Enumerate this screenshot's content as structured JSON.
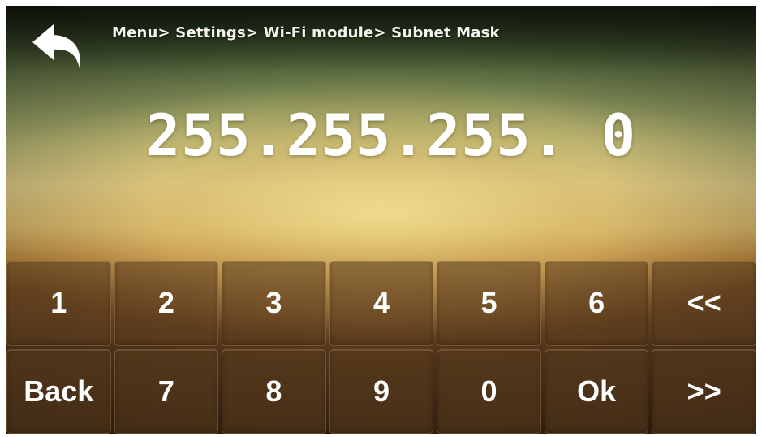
{
  "header": {
    "back_icon": "back-arrow-icon",
    "breadcrumb": "Menu> Settings> Wi-Fi module> Subnet Mask"
  },
  "display": {
    "value": "255.255.255. 0"
  },
  "keypad": {
    "row1": [
      "1",
      "2",
      "3",
      "4",
      "5",
      "6",
      "<<"
    ],
    "row2": [
      "Back",
      "7",
      "8",
      "9",
      "0",
      "Ok",
      ">>"
    ]
  },
  "colors": {
    "text": "#ffffff",
    "key_bg": "#5a3c1e"
  }
}
